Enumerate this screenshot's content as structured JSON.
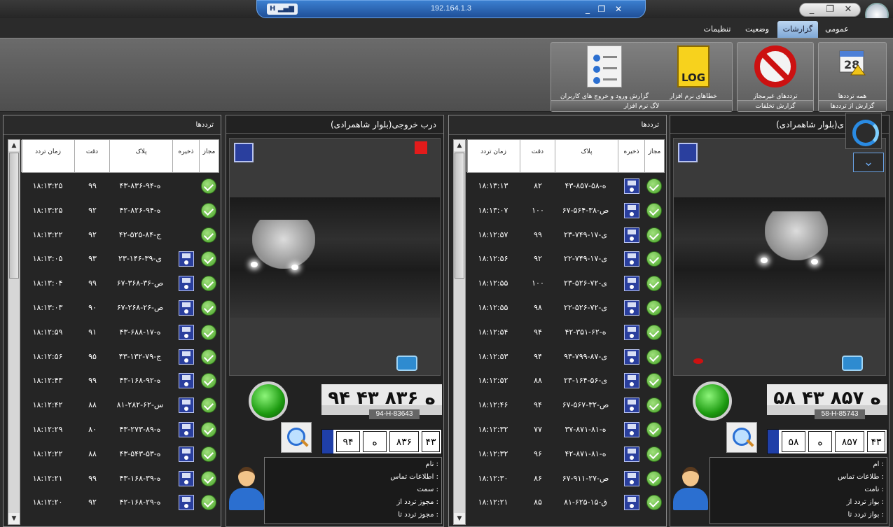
{
  "titlebar": {
    "ip": "192.164.1.3",
    "conn_badge": "H",
    "minimize": "_",
    "restore": "❐",
    "close": "✕"
  },
  "tabs": [
    {
      "label": "عمومی"
    },
    {
      "label": "گزارشات",
      "active": true
    },
    {
      "label": "وضعیت"
    },
    {
      "label": "تنظیمات"
    }
  ],
  "ribbon": {
    "groups": [
      {
        "label": "گزارش از ترددها",
        "buttons": [
          {
            "label": "همه ترددها",
            "icon": "calendar-icon"
          }
        ]
      },
      {
        "label": "گزارش تخلفات",
        "buttons": [
          {
            "label": "ترددهای غیرمجاز",
            "icon": "no-entry-icon"
          }
        ]
      },
      {
        "label": "لاگ نرم افزار",
        "buttons": [
          {
            "label": "خطاهای نرم افزار",
            "icon": "log-file-icon",
            "icon_text": "LOG"
          },
          {
            "label": "گزارش ورود و خروج های کاربران",
            "icon": "users-report-icon"
          }
        ]
      }
    ]
  },
  "left_list": {
    "title": "ترددها",
    "headers": {
      "allowed": "مجاز",
      "save": "ذخیره",
      "plate": "پلاک",
      "accuracy": "دقت",
      "time": "زمان تردد"
    },
    "rows": [
      {
        "plate": "۴۳-۸۳۶-ه-۹۴",
        "acc": "۹۹",
        "time": "۱۸:۱۳:۲۵",
        "disk": false
      },
      {
        "plate": "۴۲-۸۲۶-ه-۹۴",
        "acc": "۹۲",
        "time": "۱۸:۱۳:۲۵",
        "disk": false
      },
      {
        "plate": "۴۲-۵۲۵-ج-۸۴",
        "acc": "۹۲",
        "time": "۱۸:۱۳:۲۲",
        "disk": false
      },
      {
        "plate": "۲۳-۱۴۶-ی-۳۹",
        "acc": "۹۳",
        "time": "۱۸:۱۳:۰۵",
        "disk": true
      },
      {
        "plate": "۶۷-۳۶۸-ص-۳۶",
        "acc": "۹۹",
        "time": "۱۸:۱۳:۰۴",
        "disk": true
      },
      {
        "plate": "۶۷-۲۶۸-ص-۲۶",
        "acc": "۹۰",
        "time": "۱۸:۱۳:۰۳",
        "disk": true
      },
      {
        "plate": "۴۳-۶۸۸-ه-۱۷",
        "acc": "۹۱",
        "time": "۱۸:۱۲:۵۹",
        "disk": true
      },
      {
        "plate": "۴۳-۱۳۲-ج-۷۹",
        "acc": "۹۵",
        "time": "۱۸:۱۲:۵۶",
        "disk": true
      },
      {
        "plate": "۴۳-۱۶۸-ه-۹۲",
        "acc": "۹۹",
        "time": "۱۸:۱۲:۴۳",
        "disk": true
      },
      {
        "plate": "۸۱-۲۸۲-س-۶۲",
        "acc": "۸۸",
        "time": "۱۸:۱۲:۴۲",
        "disk": true
      },
      {
        "plate": "۴۳-۲۷۳-ه-۸۹",
        "acc": "۸۰",
        "time": "۱۸:۱۲:۲۹",
        "disk": true
      },
      {
        "plate": "۴۳-۵۴۳-ه-۵۳",
        "acc": "۸۸",
        "time": "۱۸:۱۲:۲۲",
        "disk": true
      },
      {
        "plate": "۴۳-۱۶۸-ه-۳۹",
        "acc": "۹۹",
        "time": "۱۸:۱۲:۲۱",
        "disk": true
      },
      {
        "plate": "۴۲-۱۶۸-ه-۲۹",
        "acc": "۹۲",
        "time": "۱۸:۱۲:۲۰",
        "disk": true
      }
    ]
  },
  "right_list": {
    "title": "ترددها",
    "headers": {
      "allowed": "مجاز",
      "save": "ذخیره",
      "plate": "پلاک",
      "accuracy": "دقت",
      "time": "زمان تردد"
    },
    "rows": [
      {
        "plate": "۴۳-۸۵۷-ه-۵۸",
        "acc": "۸۲",
        "time": "۱۸:۱۳:۱۳",
        "disk": true
      },
      {
        "plate": "۶۷-۵۶۴-ص-۳۸",
        "acc": "۱۰۰",
        "time": "۱۸:۱۳:۰۷",
        "disk": true
      },
      {
        "plate": "۲۳-۷۴۹-ی-۱۷",
        "acc": "۹۹",
        "time": "۱۸:۱۲:۵۷",
        "disk": true
      },
      {
        "plate": "۲۲-۷۴۹-ی-۱۷",
        "acc": "۹۲",
        "time": "۱۸:۱۲:۵۶",
        "disk": true
      },
      {
        "plate": "۲۳-۵۲۶-ی-۷۲",
        "acc": "۱۰۰",
        "time": "۱۸:۱۲:۵۵",
        "disk": true
      },
      {
        "plate": "۲۲-۵۲۶-ی-۷۲",
        "acc": "۹۸",
        "time": "۱۸:۱۲:۵۵",
        "disk": true
      },
      {
        "plate": "۴۲-۳۵۱-ه-۶۲",
        "acc": "۹۴",
        "time": "۱۸:۱۲:۵۴",
        "disk": true
      },
      {
        "plate": "۹۳-۷۹۹-ی-۸۷",
        "acc": "۹۴",
        "time": "۱۸:۱۲:۵۳",
        "disk": true
      },
      {
        "plate": "۲۳-۱۶۴-ی-۵۶",
        "acc": "۸۸",
        "time": "۱۸:۱۲:۵۲",
        "disk": true
      },
      {
        "plate": "۶۷-۵۶۷-ص-۳۲",
        "acc": "۹۴",
        "time": "۱۸:۱۲:۴۶",
        "disk": true
      },
      {
        "plate": "۳۷-۸۷۱-ه-۸۱",
        "acc": "۷۷",
        "time": "۱۸:۱۲:۳۲",
        "disk": true
      },
      {
        "plate": "۴۲-۸۷۱-ه-۸۱",
        "acc": "۹۶",
        "time": "۱۸:۱۲:۳۲",
        "disk": true
      },
      {
        "plate": "۶۷-۹۱۱-ص-۲۷",
        "acc": "۸۶",
        "time": "۱۸:۱۲:۳۰",
        "disk": true
      },
      {
        "plate": "۸۱-۶۲۵-ق-۱۵",
        "acc": "۸۵",
        "time": "۱۸:۱۲:۲۱",
        "disk": true
      }
    ]
  },
  "cam_left": {
    "title": "درب خروجی(بلوار شاهمرادی)",
    "plate_text": "۹۴ ه ۸۳۶ ۴۳",
    "plate_caption": "94-H-83643",
    "plate_cells": [
      "۹۴",
      "ه",
      "۸۳۶",
      "۴۳"
    ],
    "info": [
      "نام :",
      "اطلاعات تماس :",
      "سمت :",
      "مجوز تردد از :",
      "مجوز تردد تا :"
    ]
  },
  "cam_right": {
    "title": "ی(بلوار شاهمرادی)",
    "plate_text": "۵۸ ه ۸۵۷ ۴۳",
    "plate_caption": "58-H-85743",
    "plate_cells": [
      "۵۸",
      "ه",
      "۸۵۷",
      "۴۳"
    ],
    "info": [
      "ام :",
      "طلاعات تماس :",
      "نامت :",
      "بواز تردد از :",
      "بواز تردد تا :"
    ]
  },
  "colors": {
    "accent_blue": "#2a8be3",
    "ok_green": "#4ba52b",
    "alert_red": "#e31b1b"
  }
}
